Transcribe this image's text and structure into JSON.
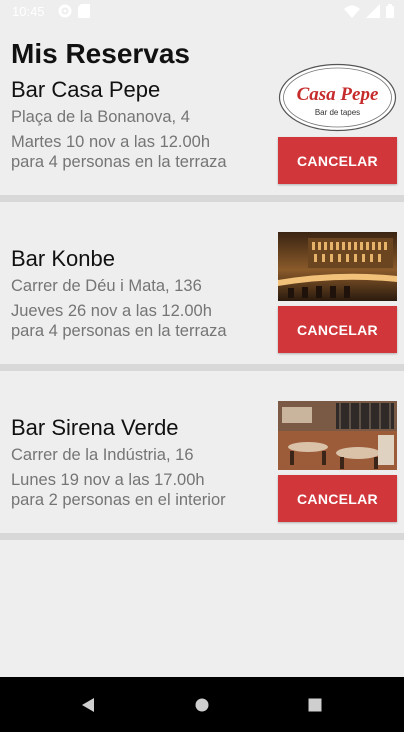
{
  "status_bar": {
    "time": "10:45",
    "icons": [
      "gear-icon",
      "sdcard-icon",
      "wifi-icon",
      "signal-icon",
      "battery-icon"
    ]
  },
  "title": "Mis Reservas",
  "reservations": [
    {
      "name": "Bar Casa Pepe",
      "address": "Plaça de la Bonanova, 4",
      "date": "Martes 10 nov a las 12.00h",
      "party": "para 4 personas en la terraza",
      "image": "casa-pepe-logo",
      "logo_text": "Casa Pepe",
      "logo_sub": "Bar de tapes",
      "cancel_label": "CANCELAR"
    },
    {
      "name": "Bar Konbe",
      "address": "Carrer de Déu i Mata, 136",
      "date": "Jueves 26 nov a las 12.00h",
      "party": "para 4 personas en la terraza",
      "image": "bar-interior-photo",
      "cancel_label": "CANCELAR"
    },
    {
      "name": "Bar Sirena Verde",
      "address": "Carrer de la Indústria, 16",
      "date": "Lunes 19 nov a las 17.00h",
      "party": "para 2 personas en el interior",
      "image": "restaurant-interior-photo",
      "cancel_label": "CANCELAR"
    }
  ],
  "colors": {
    "accent": "#d1363b",
    "background": "#eeeeee",
    "divider": "#d8d8d8"
  },
  "nav_bar": {
    "buttons": [
      "back-icon",
      "home-icon",
      "recents-icon"
    ]
  }
}
